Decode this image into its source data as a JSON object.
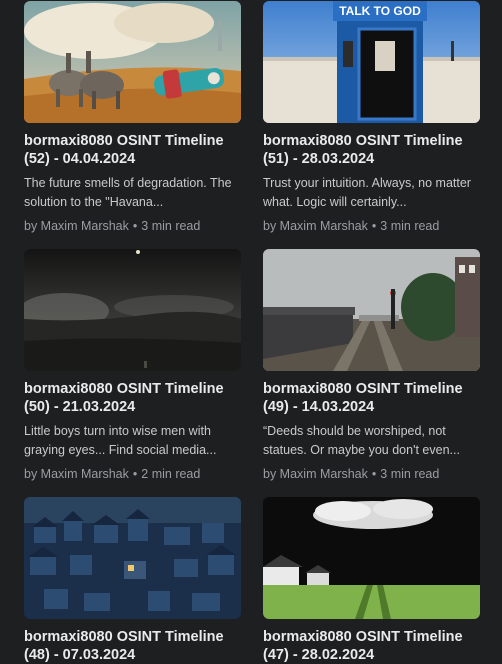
{
  "posts": [
    {
      "title": "bormaxi8080 OSINT Timeline (52) - 04.04.2024",
      "excerpt": "The future smells of degradation. The solution to the \"Havana...",
      "author": "by Maxim Marshak",
      "separator": "•",
      "read_time": "3 min read",
      "image": "surreal-elephants-desert"
    },
    {
      "title": "bormaxi8080 OSINT Timeline (51) - 28.03.2024",
      "excerpt": "Trust your intuition. Always, no matter what. Logic will certainly...",
      "author": "by Maxim Marshak",
      "separator": "•",
      "read_time": "3 min read",
      "image": "phone-booth-talk-to-god",
      "image_text": "TALK TO GOD"
    },
    {
      "title": "bormaxi8080 OSINT Timeline (50) - 21.03.2024",
      "excerpt": "Little boys turn into wise men with graying eyes... Find social media...",
      "author": "by Maxim Marshak",
      "separator": "•",
      "read_time": "2 min read",
      "image": "dark-night-landscape"
    },
    {
      "title": "bormaxi8080 OSINT Timeline (49) - 14.03.2024",
      "excerpt": "“Deeds should be worshiped, not statues. Or maybe you don't even...",
      "author": "by Maxim Marshak",
      "separator": "•",
      "read_time": "3 min read",
      "image": "railway-freight-train"
    },
    {
      "title": "bormaxi8080 OSINT Timeline (48) - 07.03.2024",
      "excerpt": "",
      "author": "",
      "separator": "",
      "read_time": "",
      "image": "night-village-illustration"
    },
    {
      "title": "bormaxi8080 OSINT Timeline (47) - 28.02.2024",
      "excerpt": "",
      "author": "",
      "separator": "",
      "read_time": "",
      "image": "cloud-over-green-field"
    }
  ]
}
